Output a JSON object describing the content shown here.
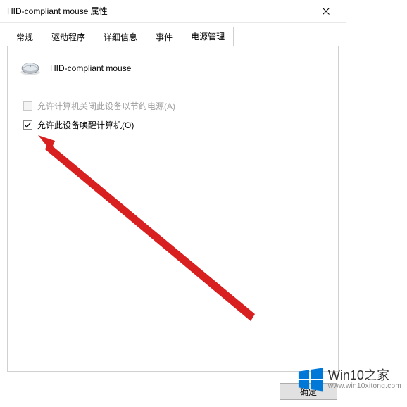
{
  "window": {
    "title": "HID-compliant mouse 属性"
  },
  "tabs": {
    "t0": "常规",
    "t1": "驱动程序",
    "t2": "详细信息",
    "t3": "事件",
    "t4": "电源管理"
  },
  "device": {
    "name": "HID-compliant mouse"
  },
  "options": {
    "allow_off_label": "允许计算机关闭此设备以节约电源(A)",
    "allow_wake_label": "允许此设备唤醒计算机(O)"
  },
  "buttons": {
    "ok": "确定"
  },
  "watermark": {
    "brand_en": "Win10",
    "brand_zh": "之家",
    "url": "www.win10xitong.com"
  }
}
